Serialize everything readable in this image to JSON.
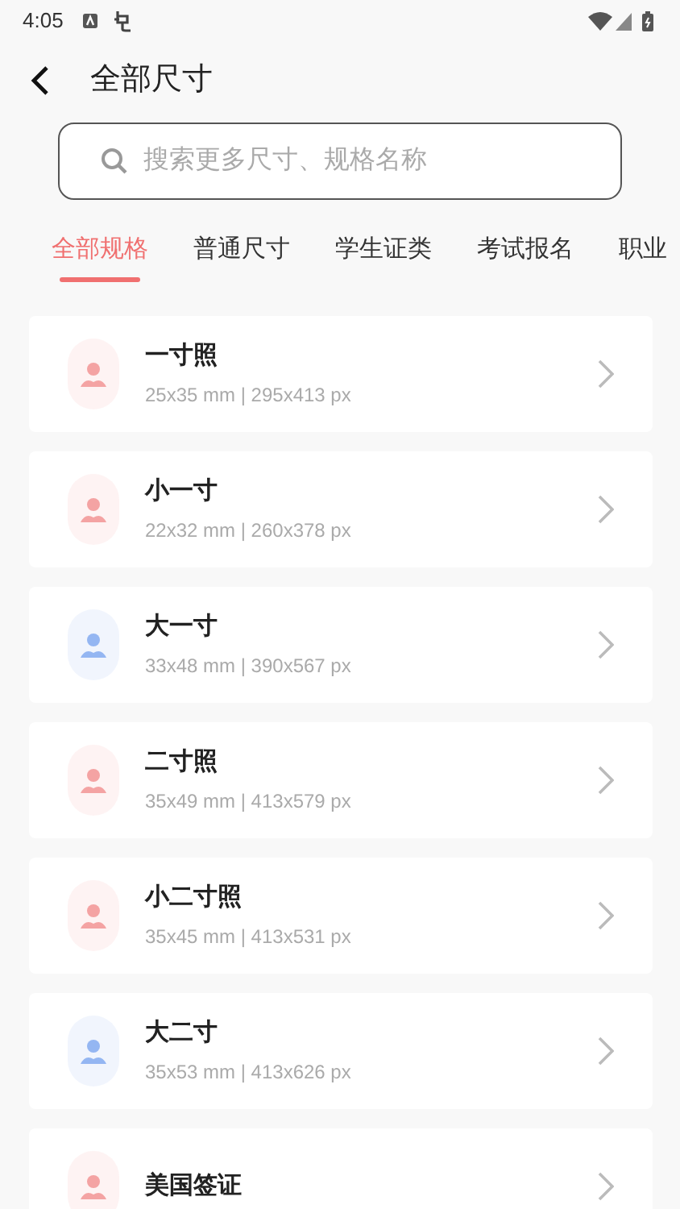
{
  "status_bar": {
    "time": "4:05"
  },
  "header": {
    "title": "全部尺寸"
  },
  "search": {
    "placeholder": "搜索更多尺寸、规格名称"
  },
  "tabs": [
    {
      "label": "全部规格",
      "selected": true
    },
    {
      "label": "普通尺寸",
      "selected": false
    },
    {
      "label": "学生证类",
      "selected": false
    },
    {
      "label": "考试报名",
      "selected": false
    },
    {
      "label": "职业",
      "selected": false
    }
  ],
  "sizes": [
    {
      "name": "一寸照",
      "spec": "25x35 mm | 295x413 px",
      "color": "#f4a3a3"
    },
    {
      "name": "小一寸",
      "spec": "22x32 mm | 260x378 px",
      "color": "#f4a3a3"
    },
    {
      "name": "大一寸",
      "spec": "33x48 mm | 390x567 px",
      "color": "#94b6f2"
    },
    {
      "name": "二寸照",
      "spec": "35x49 mm | 413x579 px",
      "color": "#f4a3a3"
    },
    {
      "name": "小二寸照",
      "spec": "35x45 mm | 413x531 px",
      "color": "#f4a3a3"
    },
    {
      "name": "大二寸",
      "spec": "35x53 mm | 413x626 px",
      "color": "#94b6f2"
    },
    {
      "name": "美国签证",
      "color": "#f4a3a3"
    }
  ]
}
